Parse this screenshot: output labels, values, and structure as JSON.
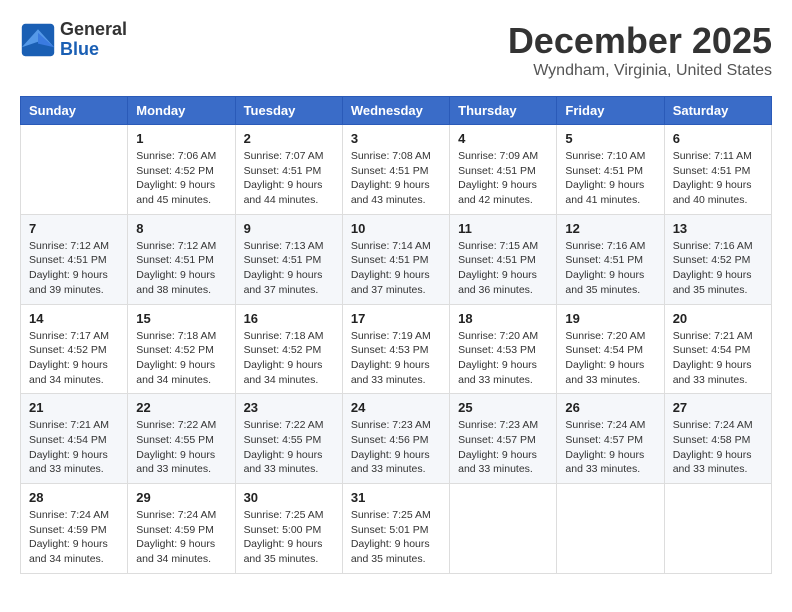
{
  "logo": {
    "general": "General",
    "blue": "Blue"
  },
  "header": {
    "month": "December 2025",
    "location": "Wyndham, Virginia, United States"
  },
  "days_of_week": [
    "Sunday",
    "Monday",
    "Tuesday",
    "Wednesday",
    "Thursday",
    "Friday",
    "Saturday"
  ],
  "weeks": [
    [
      {
        "day": "",
        "info": ""
      },
      {
        "day": "1",
        "info": "Sunrise: 7:06 AM\nSunset: 4:52 PM\nDaylight: 9 hours\nand 45 minutes."
      },
      {
        "day": "2",
        "info": "Sunrise: 7:07 AM\nSunset: 4:51 PM\nDaylight: 9 hours\nand 44 minutes."
      },
      {
        "day": "3",
        "info": "Sunrise: 7:08 AM\nSunset: 4:51 PM\nDaylight: 9 hours\nand 43 minutes."
      },
      {
        "day": "4",
        "info": "Sunrise: 7:09 AM\nSunset: 4:51 PM\nDaylight: 9 hours\nand 42 minutes."
      },
      {
        "day": "5",
        "info": "Sunrise: 7:10 AM\nSunset: 4:51 PM\nDaylight: 9 hours\nand 41 minutes."
      },
      {
        "day": "6",
        "info": "Sunrise: 7:11 AM\nSunset: 4:51 PM\nDaylight: 9 hours\nand 40 minutes."
      }
    ],
    [
      {
        "day": "7",
        "info": "Sunrise: 7:12 AM\nSunset: 4:51 PM\nDaylight: 9 hours\nand 39 minutes."
      },
      {
        "day": "8",
        "info": "Sunrise: 7:12 AM\nSunset: 4:51 PM\nDaylight: 9 hours\nand 38 minutes."
      },
      {
        "day": "9",
        "info": "Sunrise: 7:13 AM\nSunset: 4:51 PM\nDaylight: 9 hours\nand 37 minutes."
      },
      {
        "day": "10",
        "info": "Sunrise: 7:14 AM\nSunset: 4:51 PM\nDaylight: 9 hours\nand 37 minutes."
      },
      {
        "day": "11",
        "info": "Sunrise: 7:15 AM\nSunset: 4:51 PM\nDaylight: 9 hours\nand 36 minutes."
      },
      {
        "day": "12",
        "info": "Sunrise: 7:16 AM\nSunset: 4:51 PM\nDaylight: 9 hours\nand 35 minutes."
      },
      {
        "day": "13",
        "info": "Sunrise: 7:16 AM\nSunset: 4:52 PM\nDaylight: 9 hours\nand 35 minutes."
      }
    ],
    [
      {
        "day": "14",
        "info": "Sunrise: 7:17 AM\nSunset: 4:52 PM\nDaylight: 9 hours\nand 34 minutes."
      },
      {
        "day": "15",
        "info": "Sunrise: 7:18 AM\nSunset: 4:52 PM\nDaylight: 9 hours\nand 34 minutes."
      },
      {
        "day": "16",
        "info": "Sunrise: 7:18 AM\nSunset: 4:52 PM\nDaylight: 9 hours\nand 34 minutes."
      },
      {
        "day": "17",
        "info": "Sunrise: 7:19 AM\nSunset: 4:53 PM\nDaylight: 9 hours\nand 33 minutes."
      },
      {
        "day": "18",
        "info": "Sunrise: 7:20 AM\nSunset: 4:53 PM\nDaylight: 9 hours\nand 33 minutes."
      },
      {
        "day": "19",
        "info": "Sunrise: 7:20 AM\nSunset: 4:54 PM\nDaylight: 9 hours\nand 33 minutes."
      },
      {
        "day": "20",
        "info": "Sunrise: 7:21 AM\nSunset: 4:54 PM\nDaylight: 9 hours\nand 33 minutes."
      }
    ],
    [
      {
        "day": "21",
        "info": "Sunrise: 7:21 AM\nSunset: 4:54 PM\nDaylight: 9 hours\nand 33 minutes."
      },
      {
        "day": "22",
        "info": "Sunrise: 7:22 AM\nSunset: 4:55 PM\nDaylight: 9 hours\nand 33 minutes."
      },
      {
        "day": "23",
        "info": "Sunrise: 7:22 AM\nSunset: 4:55 PM\nDaylight: 9 hours\nand 33 minutes."
      },
      {
        "day": "24",
        "info": "Sunrise: 7:23 AM\nSunset: 4:56 PM\nDaylight: 9 hours\nand 33 minutes."
      },
      {
        "day": "25",
        "info": "Sunrise: 7:23 AM\nSunset: 4:57 PM\nDaylight: 9 hours\nand 33 minutes."
      },
      {
        "day": "26",
        "info": "Sunrise: 7:24 AM\nSunset: 4:57 PM\nDaylight: 9 hours\nand 33 minutes."
      },
      {
        "day": "27",
        "info": "Sunrise: 7:24 AM\nSunset: 4:58 PM\nDaylight: 9 hours\nand 33 minutes."
      }
    ],
    [
      {
        "day": "28",
        "info": "Sunrise: 7:24 AM\nSunset: 4:59 PM\nDaylight: 9 hours\nand 34 minutes."
      },
      {
        "day": "29",
        "info": "Sunrise: 7:24 AM\nSunset: 4:59 PM\nDaylight: 9 hours\nand 34 minutes."
      },
      {
        "day": "30",
        "info": "Sunrise: 7:25 AM\nSunset: 5:00 PM\nDaylight: 9 hours\nand 35 minutes."
      },
      {
        "day": "31",
        "info": "Sunrise: 7:25 AM\nSunset: 5:01 PM\nDaylight: 9 hours\nand 35 minutes."
      },
      {
        "day": "",
        "info": ""
      },
      {
        "day": "",
        "info": ""
      },
      {
        "day": "",
        "info": ""
      }
    ]
  ]
}
